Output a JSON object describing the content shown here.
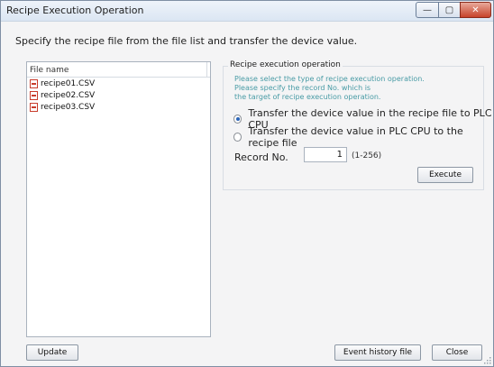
{
  "window": {
    "title": "Recipe Execution Operation"
  },
  "titlebar_buttons": {
    "minimize": "—",
    "maximize": "▢",
    "close": "✕"
  },
  "instruction": "Specify the recipe file from the file list and transfer the device value.",
  "file_list": {
    "column_header": "File name",
    "files": [
      "recipe01.CSV",
      "recipe02.CSV",
      "recipe03.CSV"
    ]
  },
  "operation_group": {
    "title": "Recipe execution operation",
    "hints": [
      "Please select the type of recipe execution operation.",
      "Please specify the record No. which is",
      "the target of recipe execution operation."
    ],
    "options": [
      {
        "label": "Transfer the device value in the recipe file to PLC CPU",
        "checked": true
      },
      {
        "label": "Transfer the device value in PLC CPU to the recipe file",
        "checked": false
      }
    ],
    "record_label": "Record No.",
    "record_value": "1",
    "record_range": "(1-256)",
    "execute_label": "Execute"
  },
  "footer": {
    "update_label": "Update",
    "event_history_label": "Event history file",
    "close_label": "Close"
  }
}
